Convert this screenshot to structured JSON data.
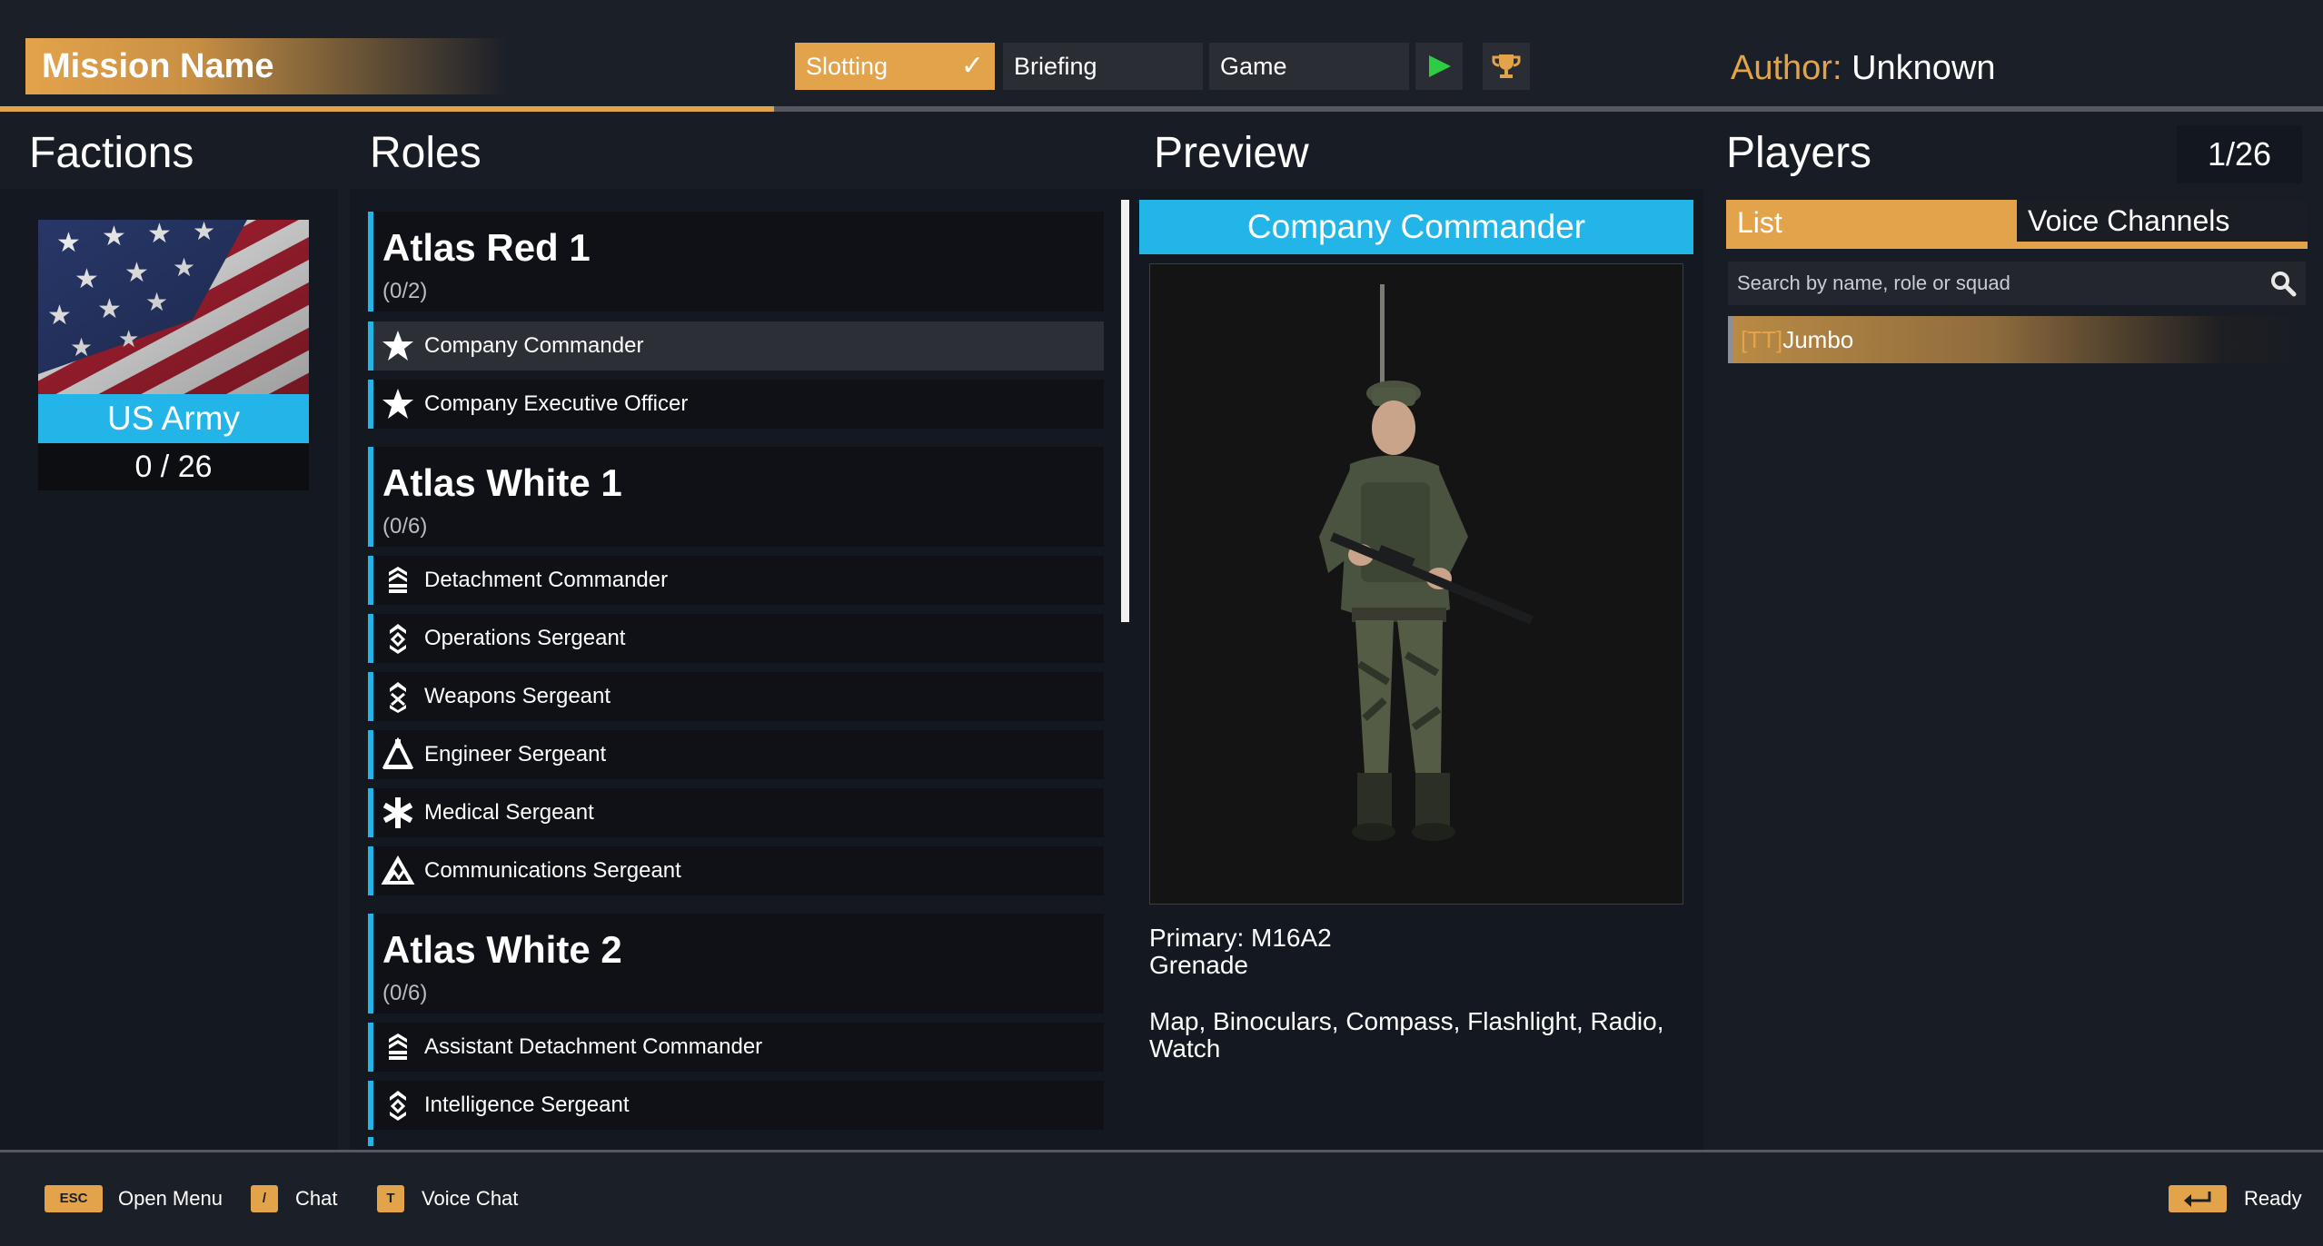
{
  "header": {
    "mission_name": "Mission Name",
    "tabs": {
      "slotting": "Slotting",
      "briefing": "Briefing",
      "game": "Game"
    },
    "author_label": "Author:",
    "author_name": "Unknown"
  },
  "sections": {
    "factions": "Factions",
    "roles": "Roles",
    "preview": "Preview",
    "players": "Players"
  },
  "faction": {
    "name": "US Army",
    "count": "0 / 26"
  },
  "role_groups": [
    {
      "name": "Atlas Red 1",
      "count": "(0/2)",
      "roles": [
        "Company Commander",
        "Company Executive Officer"
      ]
    },
    {
      "name": "Atlas White 1",
      "count": "(0/6)",
      "roles": [
        "Detachment Commander",
        "Operations Sergeant",
        "Weapons Sergeant",
        "Engineer Sergeant",
        "Medical Sergeant",
        "Communications Sergeant"
      ]
    },
    {
      "name": "Atlas White 2",
      "count": "(0/6)",
      "roles": [
        "Assistant Detachment Commander",
        "Intelligence Sergeant"
      ]
    }
  ],
  "preview": {
    "role": "Company Commander",
    "primary": "Primary: M16A2",
    "secondary": "Grenade",
    "items": "Map, Binoculars, Compass, Flashlight, Radio, Watch"
  },
  "players": {
    "count": "1/26",
    "tab_list": "List",
    "tab_voice": "Voice Channels",
    "search_placeholder": "Search by name, role or squad",
    "list": [
      {
        "tag": "[TT]",
        "name": "Jumbo"
      }
    ]
  },
  "footer": {
    "esc_key": "ESC",
    "esc_label": "Open Menu",
    "chat_key": "/",
    "chat_label": "Chat",
    "voice_key": "T",
    "voice_label": "Voice Chat",
    "ready_label": "Ready"
  },
  "colors": {
    "accent": "#e3a34b",
    "selection": "#23b5e8",
    "play": "#2ecc40"
  }
}
